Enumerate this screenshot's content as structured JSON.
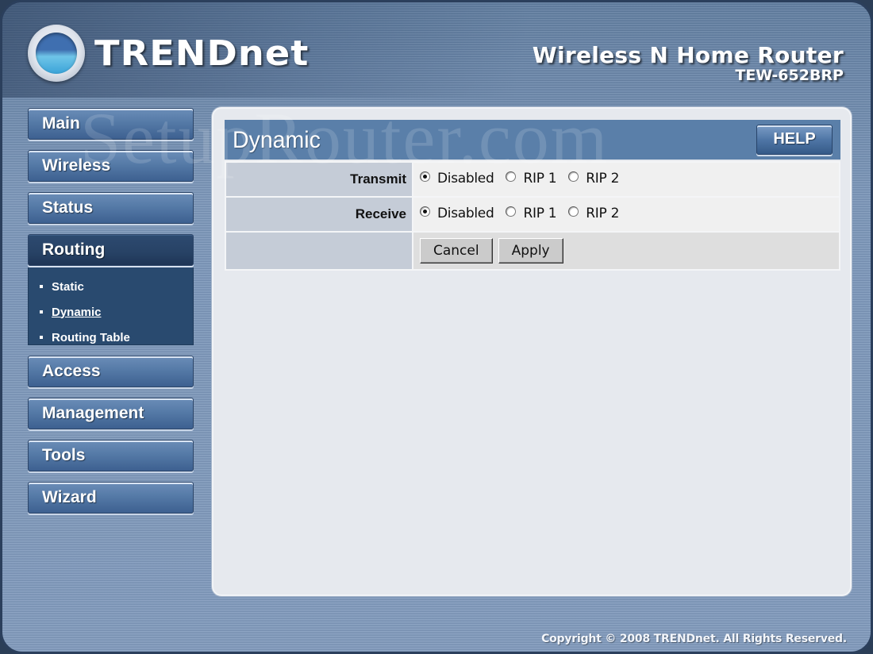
{
  "header": {
    "brand": "TRENDnet",
    "brand_icon": "trendnet-globe-logo",
    "product_name": "Wireless N Home Router",
    "model": "TEW-652BRP"
  },
  "sidebar": {
    "items": [
      {
        "label": "Main"
      },
      {
        "label": "Wireless"
      },
      {
        "label": "Status"
      },
      {
        "label": "Routing",
        "active": true,
        "children": [
          {
            "label": "Static"
          },
          {
            "label": "Dynamic",
            "current": true
          },
          {
            "label": "Routing Table"
          }
        ]
      },
      {
        "label": "Access"
      },
      {
        "label": "Management"
      },
      {
        "label": "Tools"
      },
      {
        "label": "Wizard"
      }
    ]
  },
  "main": {
    "title": "Dynamic",
    "help_label": "HELP",
    "rows": [
      {
        "label": "Transmit",
        "options": [
          "Disabled",
          "RIP 1",
          "RIP 2"
        ],
        "selected": "Disabled"
      },
      {
        "label": "Receive",
        "options": [
          "Disabled",
          "RIP 1",
          "RIP 2"
        ],
        "selected": "Disabled"
      }
    ],
    "cancel_label": "Cancel",
    "apply_label": "Apply"
  },
  "watermark": "SetupRouter.com",
  "footer": {
    "copyright": "Copyright © 2008 TRENDnet. All Rights Reserved."
  }
}
